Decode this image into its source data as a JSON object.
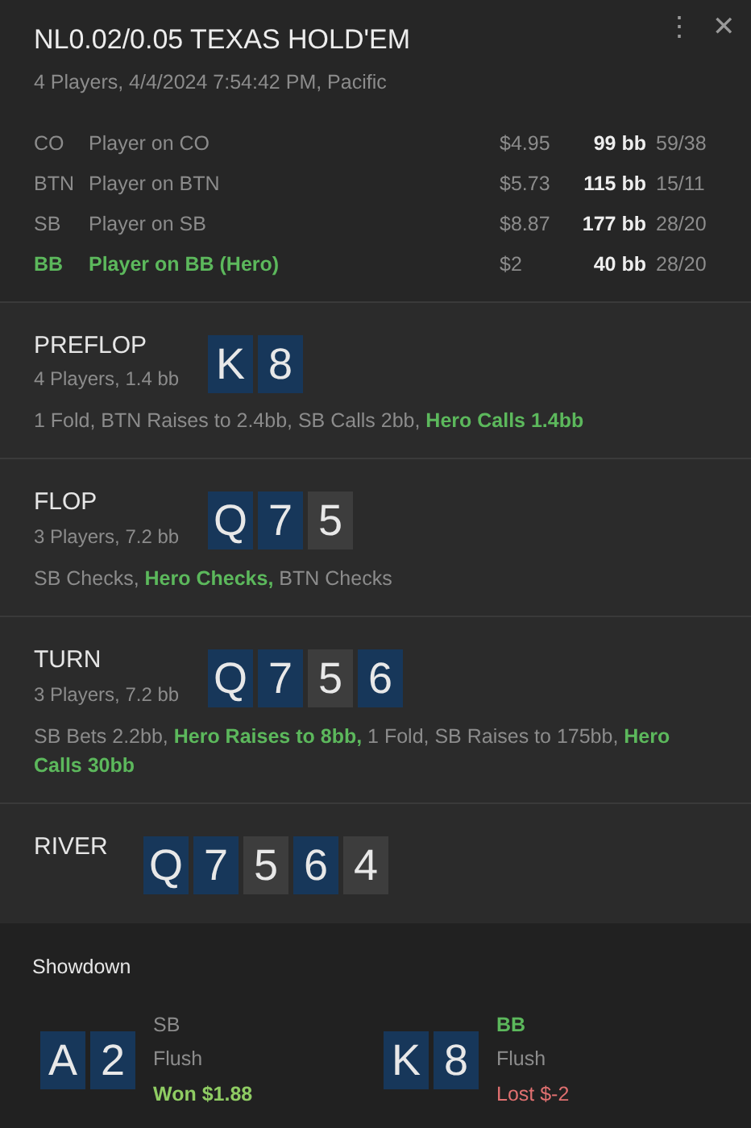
{
  "header": {
    "title": "NL0.02/0.05 TEXAS HOLD'EM",
    "subtitle": "4 Players, 4/4/2024 7:54:42 PM, Pacific",
    "menu": "⋮",
    "close": "✕"
  },
  "players": [
    {
      "position": "CO",
      "name": "Player on CO",
      "stack": "$4.95",
      "bb": "99 bb",
      "stats": "59/38",
      "hero": false
    },
    {
      "position": "BTN",
      "name": "Player on BTN",
      "stack": "$5.73",
      "bb": "115 bb",
      "stats": "15/11",
      "hero": false
    },
    {
      "position": "SB",
      "name": "Player on SB",
      "stack": "$8.87",
      "bb": "177 bb",
      "stats": "28/20",
      "hero": false
    },
    {
      "position": "BB",
      "name": "Player on BB (Hero)",
      "stack": "$2",
      "bb": "40 bb",
      "stats": "28/20",
      "hero": true
    }
  ],
  "streets": [
    {
      "name": "PREFLOP",
      "info": "4 Players, 1.4 bb",
      "cards": [
        {
          "rank": "K",
          "color": "#17375a"
        },
        {
          "rank": "8",
          "color": "#17375a"
        }
      ],
      "actions": "1 Fold, BTN Raises to 2.4bb, SB Calls 2bb, **Hero Calls 1.4bb**"
    },
    {
      "name": "FLOP",
      "info": "3 Players, 7.2 bb",
      "cards": [
        {
          "rank": "Q",
          "color": "#17375a"
        },
        {
          "rank": "7",
          "color": "#17375a"
        },
        {
          "rank": "5",
          "color": "#3d3d3d"
        }
      ],
      "actions": "SB Checks, **Hero Checks,** BTN Checks"
    },
    {
      "name": "TURN",
      "info": "3 Players, 7.2 bb",
      "cards": [
        {
          "rank": "Q",
          "color": "#17375a"
        },
        {
          "rank": "7",
          "color": "#17375a"
        },
        {
          "rank": "5",
          "color": "#3d3d3d"
        },
        {
          "rank": "6",
          "color": "#17375a"
        }
      ],
      "actions": "SB Bets 2.2bb, **Hero Raises to 8bb,** 1 Fold, SB Raises to 175bb, **Hero Calls 30bb**"
    },
    {
      "name": "RIVER",
      "cards": [
        {
          "rank": "Q",
          "color": "#17375a"
        },
        {
          "rank": "7",
          "color": "#17375a"
        },
        {
          "rank": "5",
          "color": "#3d3d3d"
        },
        {
          "rank": "6",
          "color": "#17375a"
        },
        {
          "rank": "4",
          "color": "#3d3d3d"
        }
      ]
    }
  ],
  "showdown": {
    "title": "Showdown",
    "hands": [
      {
        "cards": [
          {
            "rank": "A",
            "color": "#17375a"
          },
          {
            "rank": "2",
            "color": "#17375a"
          }
        ],
        "position": "SB",
        "hero": false,
        "hand": "Flush",
        "result": "Won $1.88",
        "kind": "won"
      },
      {
        "cards": [
          {
            "rank": "K",
            "color": "#17375a"
          },
          {
            "rank": "8",
            "color": "#17375a"
          }
        ],
        "position": "BB",
        "hero": true,
        "hand": "Flush",
        "result": "Lost $-2",
        "kind": "lost"
      }
    ]
  }
}
